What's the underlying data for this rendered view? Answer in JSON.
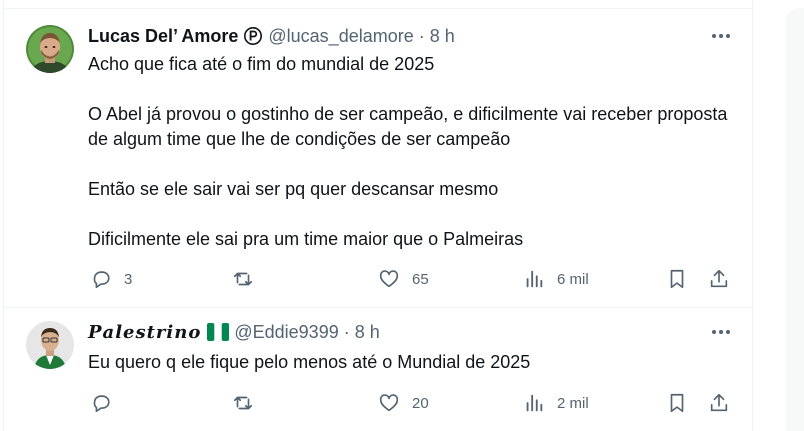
{
  "tweets": [
    {
      "display_name": "Lucas Del’ Amore",
      "badge_icon": "parody-p-icon",
      "handle": "@lucas_delamore",
      "separator": "·",
      "time": "8 h",
      "text": "Acho que fica até o fim do mundial de 2025\n\nO Abel já provou o gostinho de ser campeão, e dificilmente vai receber proposta de algum time que lhe de condições de ser campeão\n\nEntão se ele sair vai ser pq quer descansar mesmo\n\nDificilmente ele sai pra um time maior que o Palmeiras",
      "replies": "3",
      "retweets": "",
      "likes": "65",
      "views": "6 mil"
    },
    {
      "display_name": "𝑷𝒂𝒍𝒆𝒔𝒕𝒓𝒊𝒏𝒐",
      "flag_icon": "nigeria-flag-icon",
      "handle": "@Eddie9399",
      "separator": "·",
      "time": "8 h",
      "text": "Eu quero q ele fique pelo menos até o Mundial de 2025",
      "replies": "",
      "retweets": "",
      "likes": "20",
      "views": "2 mil"
    }
  ],
  "colors": {
    "text": "#0f1419",
    "secondary": "#536471",
    "border": "#eff3f4",
    "flag_green": "#008751"
  }
}
